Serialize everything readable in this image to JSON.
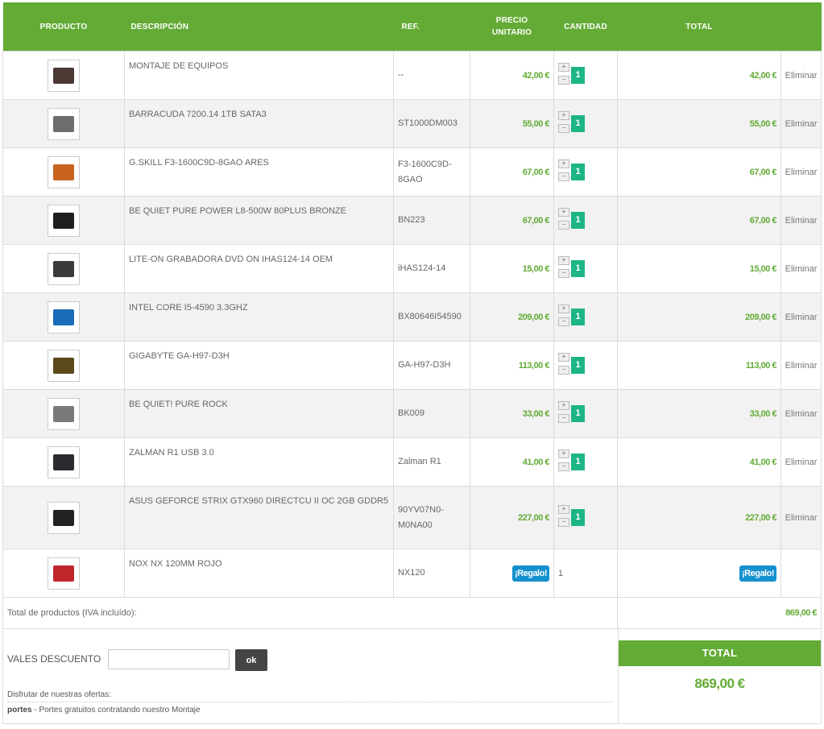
{
  "headers": {
    "producto": "PRODUCTO",
    "descripcion": "DESCRIPCIÓN",
    "ref": "REF.",
    "precio_line1": "PRECIO",
    "precio_line2": "UNITARIO",
    "cantidad": "CANTIDAD",
    "total": "TOTAL"
  },
  "items": [
    {
      "description": "MONTAJE DE EQUIPOS",
      "ref": "--",
      "unit_price": "42,00 €",
      "quantity": "1",
      "total": "42,00 €",
      "remove": "Eliminar",
      "icon": "assembly-photo-icon",
      "thumb_color": "#4a3a33"
    },
    {
      "description": "BARRACUDA 7200.14 1TB SATA3",
      "ref": "ST1000DM003",
      "unit_price": "55,00 €",
      "quantity": "1",
      "total": "55,00 €",
      "remove": "Eliminar",
      "icon": "hard-drive-icon",
      "thumb_color": "#6d6d6d"
    },
    {
      "description": "G.SKILL F3-1600C9D-8GAO ARES",
      "ref": "F3-1600C9D-8GAO",
      "unit_price": "67,00 €",
      "quantity": "1",
      "total": "67,00 €",
      "remove": "Eliminar",
      "icon": "ram-module-icon",
      "thumb_color": "#c8641e"
    },
    {
      "description": "BE QUIET PURE POWER L8-500W 80PLUS BRONZE",
      "ref": "BN223",
      "unit_price": "67,00 €",
      "quantity": "1",
      "total": "67,00 €",
      "remove": "Eliminar",
      "icon": "power-supply-icon",
      "thumb_color": "#1f1f1f"
    },
    {
      "description": "LITE-ON GRABADORA DVD ON IHAS124-14 OEM",
      "ref": "iHAS124-14",
      "unit_price": "15,00 €",
      "quantity": "1",
      "total": "15,00 €",
      "remove": "Eliminar",
      "icon": "dvd-drive-icon",
      "thumb_color": "#3b3b3b"
    },
    {
      "description": "INTEL CORE I5-4590 3.3GHZ",
      "ref": "BX80646I54590",
      "unit_price": "209,00 €",
      "quantity": "1",
      "total": "209,00 €",
      "remove": "Eliminar",
      "icon": "cpu-box-icon",
      "thumb_color": "#1a6bb8"
    },
    {
      "description": "GIGABYTE GA-H97-D3H",
      "ref": "GA-H97-D3H",
      "unit_price": "113,00 €",
      "quantity": "1",
      "total": "113,00 €",
      "remove": "Eliminar",
      "icon": "motherboard-icon",
      "thumb_color": "#5a4a1a"
    },
    {
      "description": "BE QUIET! PURE ROCK",
      "ref": "BK009",
      "unit_price": "33,00 €",
      "quantity": "1",
      "total": "33,00 €",
      "remove": "Eliminar",
      "icon": "cpu-cooler-icon",
      "thumb_color": "#7a7a7a"
    },
    {
      "description": "ZALMAN R1 USB 3.0",
      "ref": "Zalman R1",
      "unit_price": "41,00 €",
      "quantity": "1",
      "total": "41,00 €",
      "remove": "Eliminar",
      "icon": "pc-case-icon",
      "thumb_color": "#2a2a30"
    },
    {
      "description": "ASUS GEFORCE STRIX GTX960 DIRECTCU II OC 2GB GDDR5",
      "ref": "90YV07N0-M0NA00",
      "unit_price": "227,00 €",
      "quantity": "1",
      "total": "227,00 €",
      "remove": "Eliminar",
      "icon": "graphics-card-icon",
      "thumb_color": "#222222"
    },
    {
      "description": "NOX NX 120MM ROJO",
      "ref": "NX120",
      "unit_price": "¡Regalo!",
      "quantity": "1",
      "total": "¡Regalo!",
      "remove": "",
      "icon": "red-fan-icon",
      "thumb_color": "#c0272d",
      "gift": true
    }
  ],
  "summary": {
    "label": "Total de productos (IVA incluído):",
    "value": "869,00 €"
  },
  "voucher": {
    "label": "VALES DESCUENTO",
    "input_value": "",
    "button": "ok",
    "offers_title": "Disfrutar de nuestras ofertas:",
    "offer_code": "portes",
    "offer_text": " - Portes gratuitos contratando nuestro Montaje"
  },
  "total_box": {
    "title": "TOTAL",
    "value": "869,00 €"
  },
  "colors": {
    "brand_green": "#63ab35",
    "quantity_green": "#1db586",
    "gift_blue": "#1591cf"
  }
}
